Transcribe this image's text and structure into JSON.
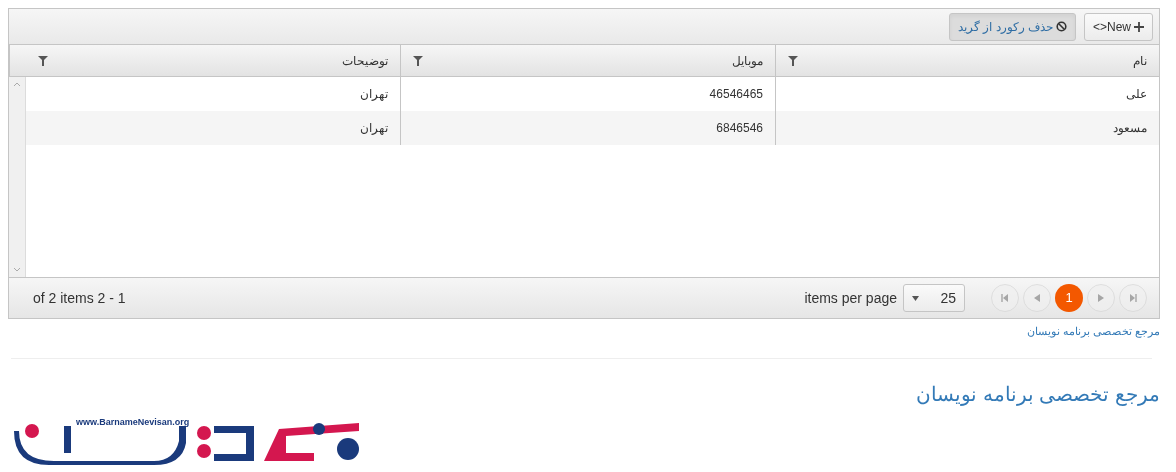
{
  "toolbar": {
    "buttons": [
      {
        "kind": "add",
        "label": "<>New",
        "pressed": false
      },
      {
        "kind": "delete",
        "label": "حذف رکورد از گرید",
        "pressed": true
      }
    ]
  },
  "grid": {
    "columns": [
      "نام",
      "موبایل",
      "توضیحات"
    ],
    "rows": [
      [
        "علی",
        "46546465",
        "تهران"
      ],
      [
        "مسعود",
        "6846546",
        "تهران"
      ]
    ]
  },
  "pager": {
    "pages": [
      {
        "label": "1",
        "selected": true
      }
    ],
    "page_size": "25",
    "page_size_label": "items per page",
    "info": "of 2 items 2 - 1"
  },
  "footer_link": "مرجع تخصصی برنامه نویسان",
  "heading": "مرجع تخصصی برنامه نویسان",
  "logo": {
    "url_text": "www.BarnameNevisan.org"
  }
}
